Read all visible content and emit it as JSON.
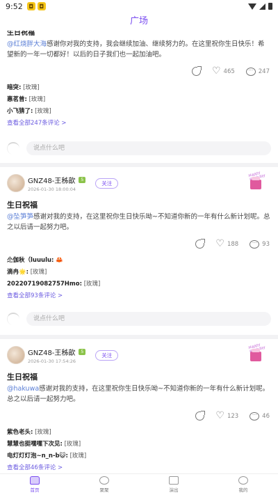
{
  "status_bar": {
    "time": "9:52"
  },
  "header": {
    "title": "广场"
  },
  "posts": [
    {
      "partial_title": "生日祝福",
      "body_mention": "@红烧胖大海",
      "body_text": "感谢你对我的支持，我会继续加油、继续努力的。在这里祝你生日快乐！希望新的一年一切都好！以后的日子我们也一起加油吧。",
      "likes": "465",
      "comment_count": "247",
      "comments": [
        {
          "user": "暗突:",
          "text": "[玫瑰]"
        },
        {
          "user": "惠茗曾:",
          "text": "[玫瑰]"
        },
        {
          "user": "小飞猜了:",
          "text": "[玫瑰]"
        }
      ],
      "view_all": "查看全部247条评论 >",
      "input_placeholder": "说点什么吧"
    },
    {
      "author": "GNZ48-王秭歆",
      "level": "5",
      "time": "2026-01-30 18:00:04",
      "follow": "关注",
      "sticker_text": "Happy Birthday",
      "title": "生日祝福",
      "body_mention": "@坠笋笋",
      "body_text": "感谢对我的支持，在这里祝你生日快乐呦~不知道你新的一年有什么新计划呢。总之以后请一起努力吧。",
      "likes": "188",
      "comment_count": "93",
      "comments": [
        {
          "user": "尐伽秋（luuulu:",
          "text": "🦀"
        },
        {
          "user": "滴冉🌟:",
          "text": "[玫瑰]"
        },
        {
          "user": "20220719082757Hmo:",
          "text": "[玫瑰]"
        }
      ],
      "view_all": "查看全部93条评论 >",
      "input_placeholder": "说点什么吧"
    },
    {
      "author": "GNZ48-王秭歆",
      "level": "5",
      "time": "2026-01-30 17:54:26",
      "follow": "关注",
      "sticker_text": "Happy Birthday",
      "title": "生日祝福",
      "body_mention": "@hakuwa",
      "body_text": "感谢对我的支持，在这里祝你生日快乐呦~不知道你新的一年有什么新计划呢。总之以后请一起努力吧。",
      "likes": "123",
      "comment_count": "46",
      "comments": [
        {
          "user": "紫色老头:",
          "text": "[玫瑰]"
        },
        {
          "user": "慧慧也挺嘿嘿下次见:",
          "text": "[玫瑰]"
        },
        {
          "user": "电灯灯灯泡~n_n-b😺:",
          "text": "[玫瑰]"
        }
      ],
      "view_all": "查看全部46条评论 >"
    }
  ],
  "bottom_nav": [
    {
      "label": "首页"
    },
    {
      "label": "聚聚"
    },
    {
      "label": "演出"
    },
    {
      "label": "我的"
    }
  ],
  "colors": {
    "accent": "#7a4df0",
    "link": "#5b7fd6"
  }
}
